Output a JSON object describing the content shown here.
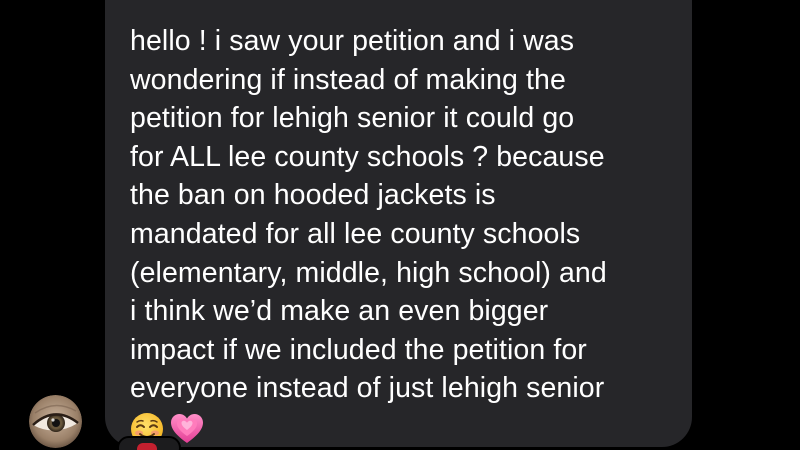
{
  "message": {
    "lines": [
      "hello ! i saw your petition and i was",
      "wondering if instead of making the",
      "petition for lehigh senior it could go",
      "for ALL lee county schools ? because",
      "the ban on hooded jackets is",
      "mandated for all lee county schools",
      "(elementary, middle, high school) and",
      "i think we’d make an even bigger",
      "impact if we included the petition for",
      "everyone instead of just lehigh senior"
    ],
    "emojis": [
      "smiling-face-icon",
      "growing-heart-icon"
    ]
  },
  "avatar": {
    "icon": "eye-icon"
  },
  "reaction": {
    "icon": "heart-icon",
    "color": "#c4202f"
  },
  "colors": {
    "background": "#000000",
    "bubble": "#262629",
    "text": "#ffffff"
  }
}
